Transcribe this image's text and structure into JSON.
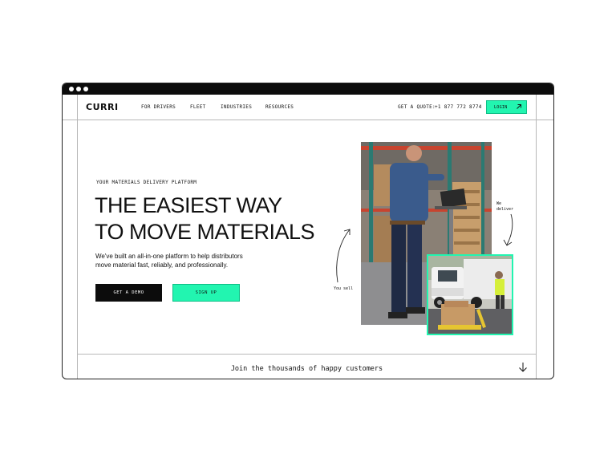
{
  "nav": {
    "logo": "CURRI",
    "links": [
      "FOR DRIVERS",
      "FLEET",
      "INDUSTRIES",
      "RESOURCES"
    ],
    "quote_label": "GET A QUOTE:",
    "phone": "+1 877 772 8774",
    "login_label": "LOGIN"
  },
  "hero": {
    "eyebrow": "YOUR MATERIALS DELIVERY PLATFORM",
    "headline_line1": "THE EASIEST WAY",
    "headline_line2": "TO MOVE MATERIALS",
    "body_line1": "We've built an all-in-one platform to help distributors",
    "body_line2": "move material fast, reliably, and professionally.",
    "demo_label": "GET A DEMO",
    "signup_label": "SIGN UP",
    "note_sell": "You sell",
    "note_deliver_line1": "We",
    "note_deliver_line2": "deliver"
  },
  "footer": {
    "text": "Join the thousands of happy customers"
  },
  "colors": {
    "accent": "#22f5b0",
    "dark": "#0c0c0c",
    "border": "#b8b8b8"
  },
  "icons": [
    "arrow-up-right-icon",
    "arrow-down-icon",
    "curved-arrow-icon"
  ]
}
